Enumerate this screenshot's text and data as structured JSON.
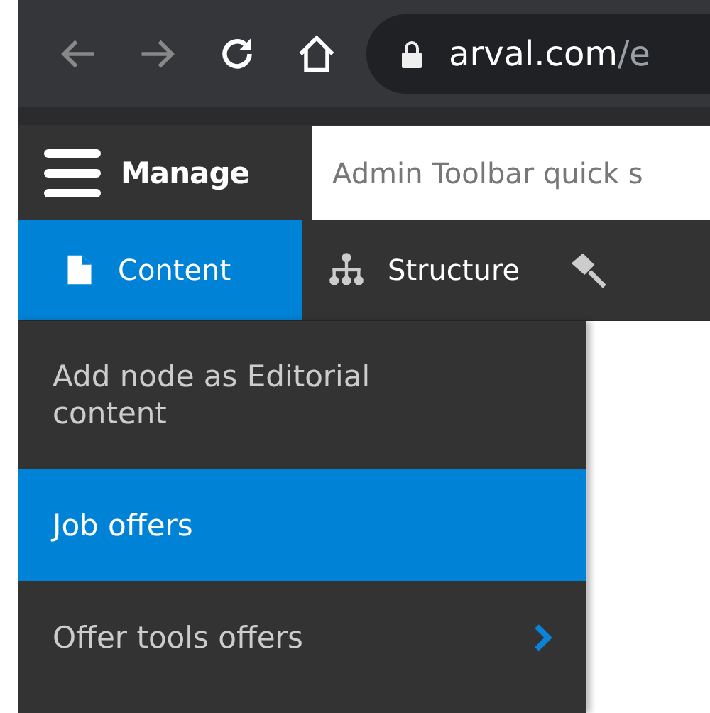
{
  "browser": {
    "url_host": "arval.com",
    "url_rest": "/e"
  },
  "toolbar": {
    "manage_label": "Manage",
    "search": {
      "placeholder": "Admin Toolbar quick s"
    }
  },
  "tabs": [
    {
      "label": "Content",
      "kind": "document",
      "selected": true
    },
    {
      "label": "Structure",
      "kind": "sitemap",
      "selected": false
    },
    {
      "kind": "brush",
      "selected": false
    }
  ],
  "menu": [
    {
      "label": "Add node as Editorial content",
      "selected": false,
      "has_children": false
    },
    {
      "label": "Job offers",
      "selected": true,
      "has_children": false
    },
    {
      "label": "Offer tools offers",
      "selected": false,
      "has_children": true
    }
  ]
}
